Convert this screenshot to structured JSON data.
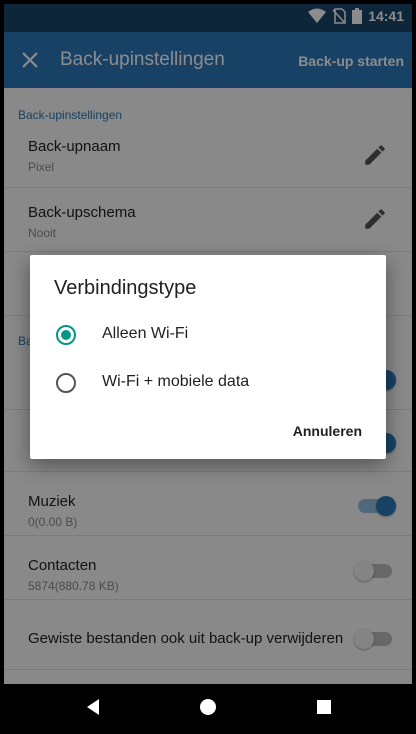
{
  "status_bar": {
    "time": "14:41",
    "icons": [
      "wifi-icon",
      "no-sim-icon",
      "battery-icon"
    ]
  },
  "app_bar": {
    "title": "Back-upinstellingen",
    "action": "Back-up starten",
    "close_icon": "close-icon"
  },
  "settings": {
    "section_header": "Back-upinstellingen",
    "section_header_2_partial": "Ba",
    "rows": [
      {
        "primary": "Back-upnaam",
        "secondary": "Pixel",
        "icon": "edit-icon"
      },
      {
        "primary": "Back-upschema",
        "secondary": "Nooit",
        "icon": "edit-icon"
      }
    ],
    "toggle_rows": [
      {
        "primary": "Muziek",
        "secondary": "0(0.00 B)",
        "enabled": true
      },
      {
        "primary": "Contacten",
        "secondary": "5874(880.78 KB)",
        "enabled": false
      },
      {
        "primary": "Gewiste bestanden ook uit back-up verwijderen",
        "secondary": "",
        "enabled": false
      }
    ]
  },
  "dialog": {
    "title": "Verbindingstype",
    "options": [
      {
        "label": "Alleen Wi-Fi",
        "selected": true
      },
      {
        "label": "Wi-Fi + mobiele data",
        "selected": false
      }
    ],
    "cancel_label": "Annuleren"
  },
  "nav_bar": {
    "buttons": [
      "back-icon",
      "home-icon",
      "recents-icon"
    ]
  },
  "colors": {
    "primary": "#2b77b8",
    "primary_dark": "#1a466b",
    "accent": "#009688"
  }
}
